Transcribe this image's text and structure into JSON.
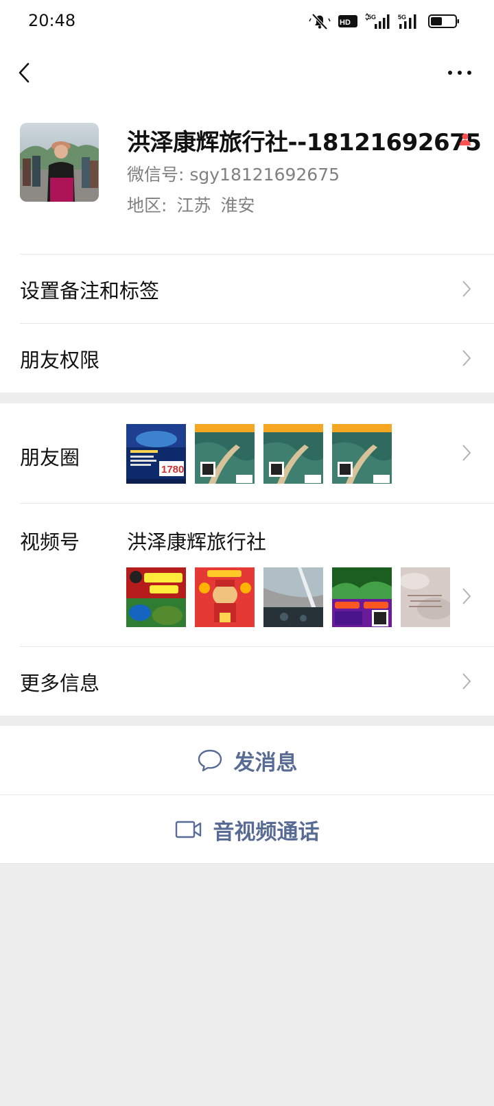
{
  "status_bar": {
    "time": "20:48",
    "network_labels": [
      "5G",
      "5G"
    ],
    "hd_label": "HD"
  },
  "profile": {
    "name": "洪泽康辉旅行社--18121692675",
    "wechat_id": "微信号: sgy18121692675",
    "region_label": "地区:",
    "region_province": "江苏",
    "region_city": "淮安",
    "gender_icon": "female-user-icon",
    "gender_color": "#fa5151"
  },
  "rows": {
    "remark_label": "设置备注和标签",
    "permissions_label": "朋友权限",
    "moments_label": "朋友圈",
    "channels_label": "视频号",
    "channels_name": "洪泽康辉旅行社",
    "more_info_label": "更多信息"
  },
  "moments_thumbs": [
    {
      "name": "moments-thumb-1",
      "price_text": "1780"
    },
    {
      "name": "moments-thumb-2"
    },
    {
      "name": "moments-thumb-3"
    },
    {
      "name": "moments-thumb-4"
    }
  ],
  "channels_thumbs": [
    {
      "name": "channels-thumb-1"
    },
    {
      "name": "channels-thumb-2"
    },
    {
      "name": "channels-thumb-3"
    },
    {
      "name": "channels-thumb-4"
    },
    {
      "name": "channels-thumb-5"
    }
  ],
  "actions": {
    "message_label": "发消息",
    "call_label": "音视频通话",
    "accent_color": "#576b95"
  },
  "colors": {
    "page_bg": "#ededed",
    "card_bg": "#ffffff",
    "secondary_text": "#808080"
  }
}
